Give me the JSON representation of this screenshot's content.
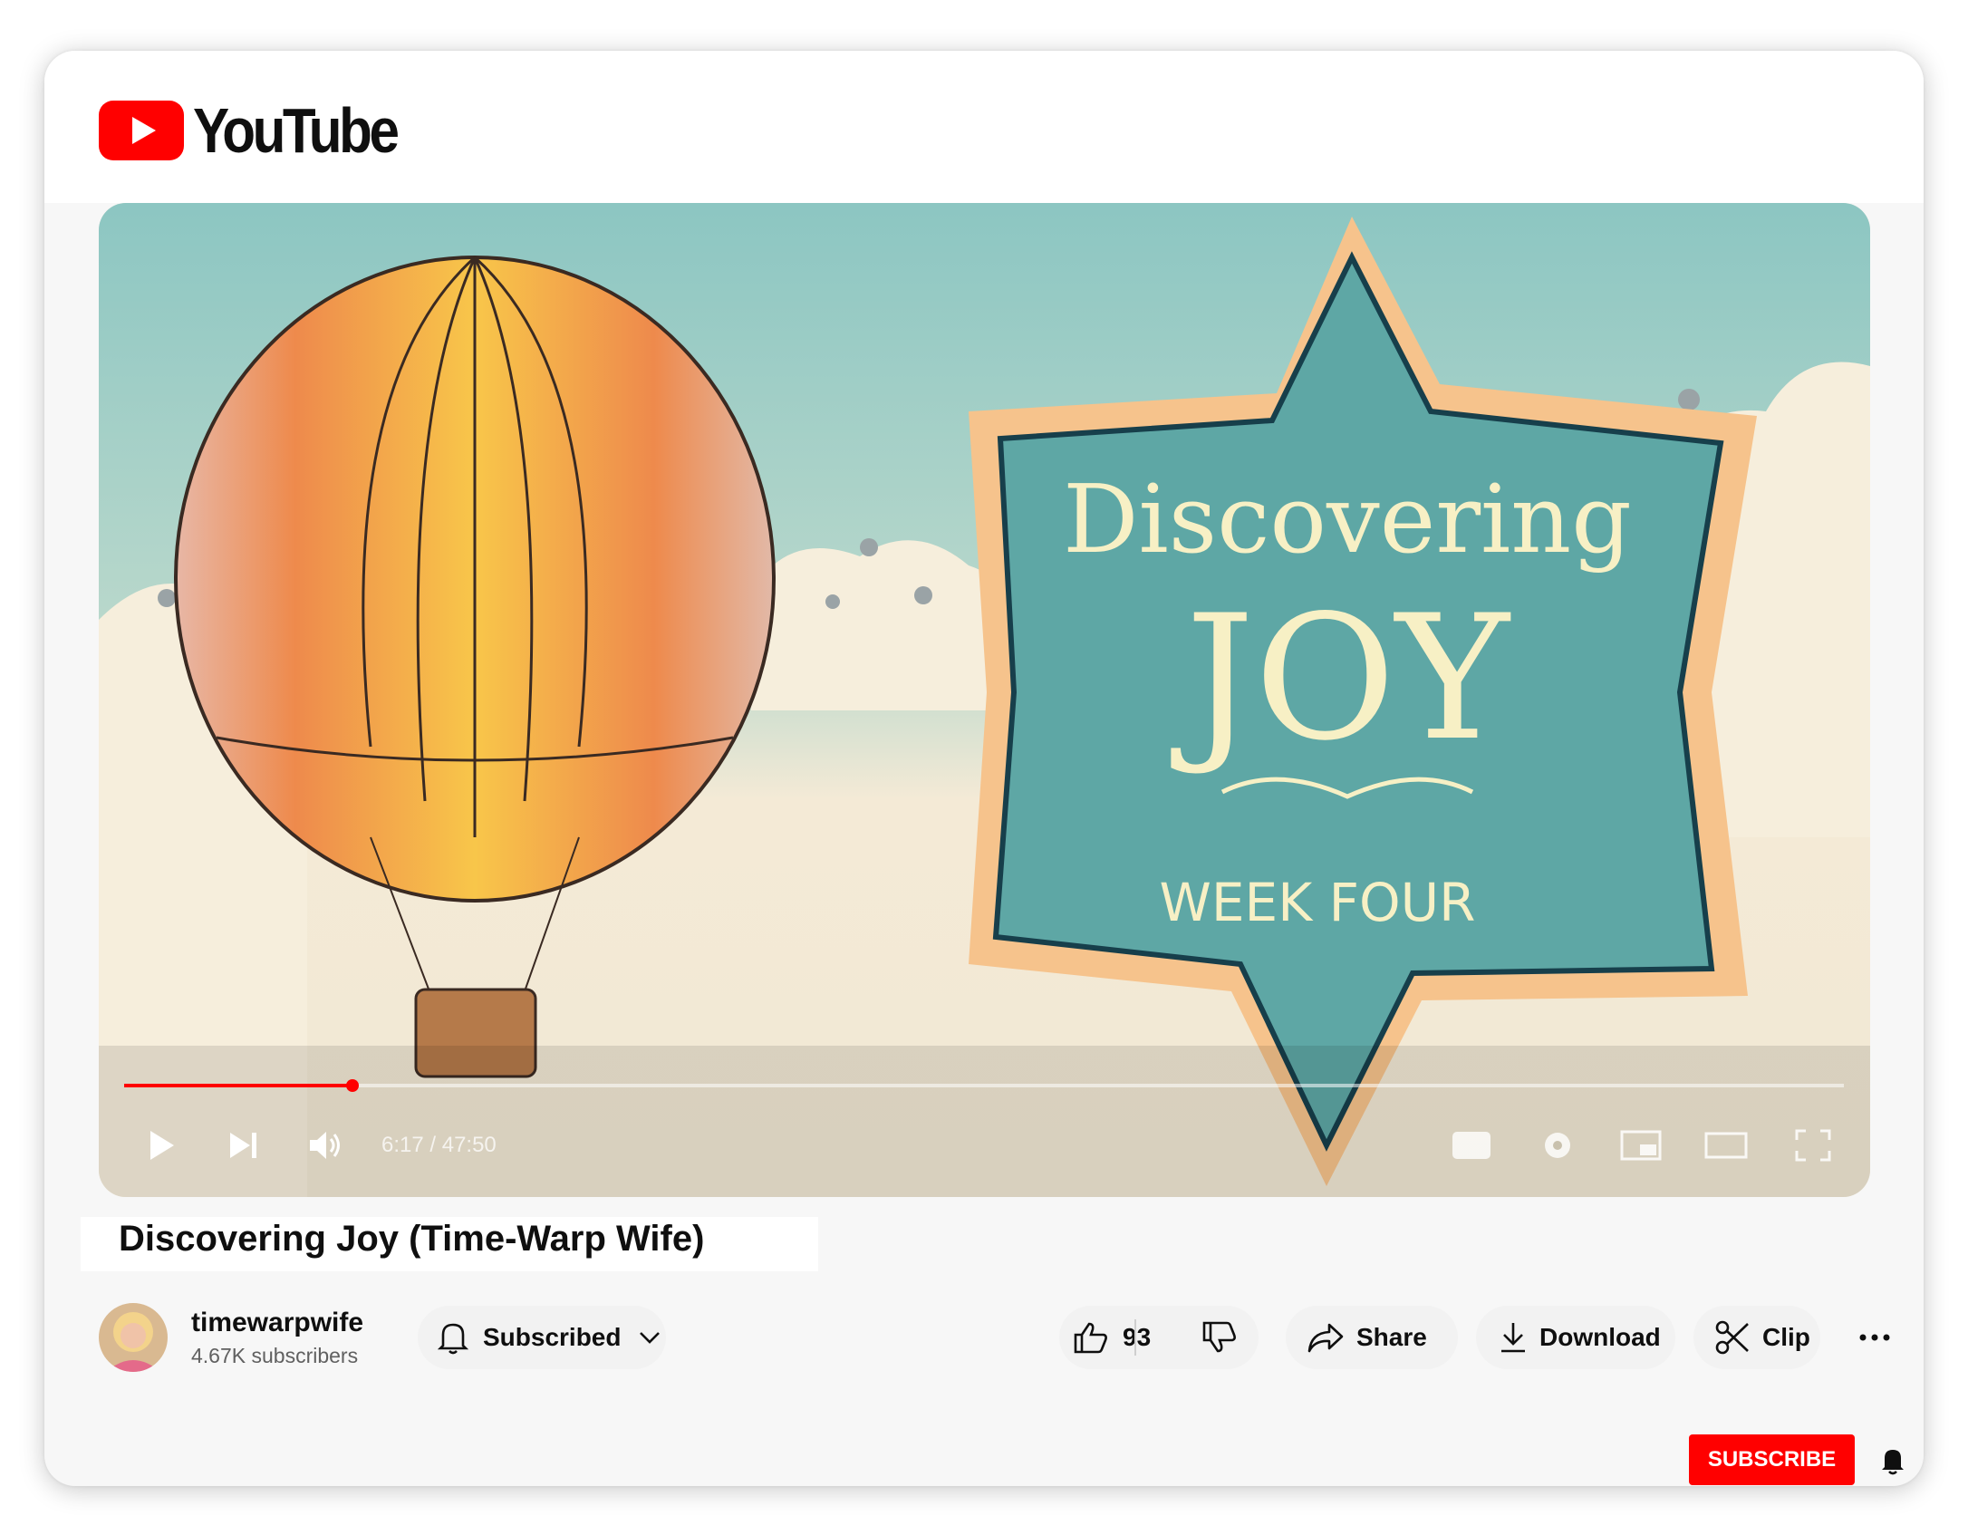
{
  "brand": {
    "name": "YouTube",
    "accent": "#ff0000"
  },
  "video": {
    "title": "Discovering Joy (Time-Warp Wife)",
    "thumbnail_text": {
      "line1": "Discovering",
      "line2": "JOY",
      "line3": "WEEK FOUR"
    },
    "time_display": "6:17 / 47:50",
    "progress": 0.133
  },
  "channel": {
    "name": "timewarpwife",
    "subscribers": "4.67K subscribers"
  },
  "actions": {
    "subscribed_label": "Subscribed",
    "like_count": "93",
    "share_label": "Share",
    "download_label": "Download",
    "clip_label": "Clip",
    "subscribe_label": "SUBSCRIBE"
  },
  "icons": {
    "logo": "youtube-play-logo",
    "play": "play-icon",
    "next": "next-icon",
    "volume": "volume-icon",
    "captions": "captions-icon",
    "settings": "settings-icon",
    "miniplayer": "miniplayer-icon",
    "theater": "theater-icon",
    "fullscreen": "fullscreen-icon",
    "bell": "bell-icon",
    "chevron": "chevron-down-icon",
    "like": "thumbs-up-icon",
    "dislike": "thumbs-down-icon",
    "share": "share-arrow-icon",
    "download": "download-icon",
    "clip": "scissors-icon",
    "more": "more-dots-icon"
  }
}
